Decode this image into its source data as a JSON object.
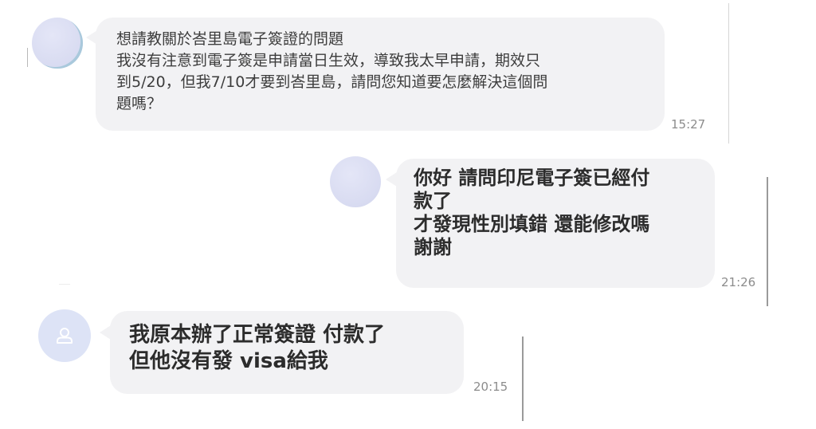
{
  "messages": [
    {
      "text": "想請教關於峇里島電子簽證的問題\n我沒有注意到電子簽是申請當日生效，導致我太早申請，期效只\n到5/20，但我7/10才要到峇里島，請問您知道要怎麼解決這個問\n題嗎？",
      "time": "15:27"
    },
    {
      "text": "你好 請問印尼電子簽已經付\n款了\n才發現性別填錯 還能修改嗎\n謝謝",
      "time": "21:26"
    },
    {
      "text": "我原本辦了正常簽證 付款了\n但他沒有發 visa給我",
      "time": "20:15"
    }
  ],
  "icons": {
    "default_avatar": "user-outline-icon"
  },
  "colors": {
    "bubble": "#f2f2f4",
    "avatar": "#dde3f6",
    "timestamp": "#8c8c8c"
  }
}
